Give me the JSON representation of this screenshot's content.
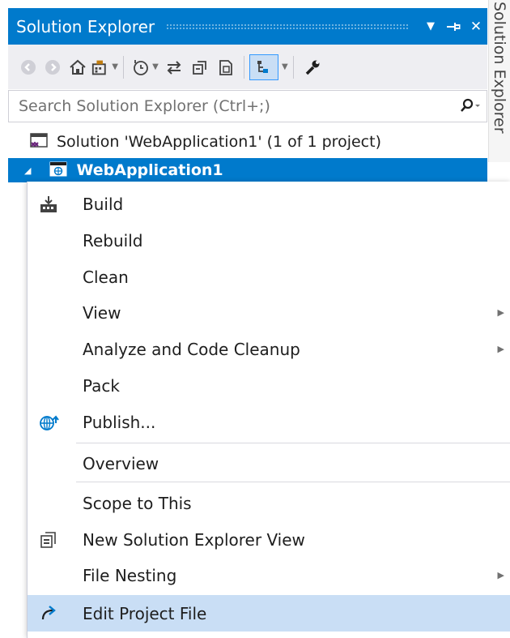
{
  "panel": {
    "title": "Solution Explorer",
    "vertical_tab": "Solution Explorer",
    "controls": {
      "dropdown": "▼",
      "pin": "⊣",
      "close": "✕"
    }
  },
  "toolbar": {
    "icons": [
      "back-icon",
      "forward-icon",
      "home-icon",
      "switch-views-icon",
      "pending-changes-filter-icon",
      "sync-icon",
      "collapse-all-icon",
      "show-all-files-icon",
      "preview-selected-icon",
      "properties-icon"
    ]
  },
  "search": {
    "placeholder": "Search Solution Explorer (Ctrl+;)"
  },
  "tree": {
    "solution_label": "Solution 'WebApplication1' (1 of 1 project)",
    "project_label": "WebApplication1"
  },
  "context_menu": {
    "items": [
      {
        "label": "Build",
        "icon": "build-icon",
        "submenu": false
      },
      {
        "label": "Rebuild",
        "icon": "",
        "submenu": false
      },
      {
        "label": "Clean",
        "icon": "",
        "submenu": false
      },
      {
        "label": "View",
        "icon": "",
        "submenu": true
      },
      {
        "label": "Analyze and Code Cleanup",
        "icon": "",
        "submenu": true
      },
      {
        "label": "Pack",
        "icon": "",
        "submenu": false
      },
      {
        "label": "Publish...",
        "icon": "publish-icon",
        "submenu": false
      },
      {
        "label": "Overview",
        "icon": "",
        "submenu": false
      },
      {
        "label": "Scope to This",
        "icon": "",
        "submenu": false
      },
      {
        "label": "New Solution Explorer View",
        "icon": "new-view-icon",
        "submenu": false
      },
      {
        "label": "File Nesting",
        "icon": "",
        "submenu": true
      },
      {
        "label": "Edit Project File",
        "icon": "edit-icon",
        "submenu": false,
        "highlighted": true
      }
    ]
  },
  "colors": {
    "accent": "#007acc",
    "toolbar_bg": "#eeeef2",
    "menu_highlight": "#c9def5"
  }
}
